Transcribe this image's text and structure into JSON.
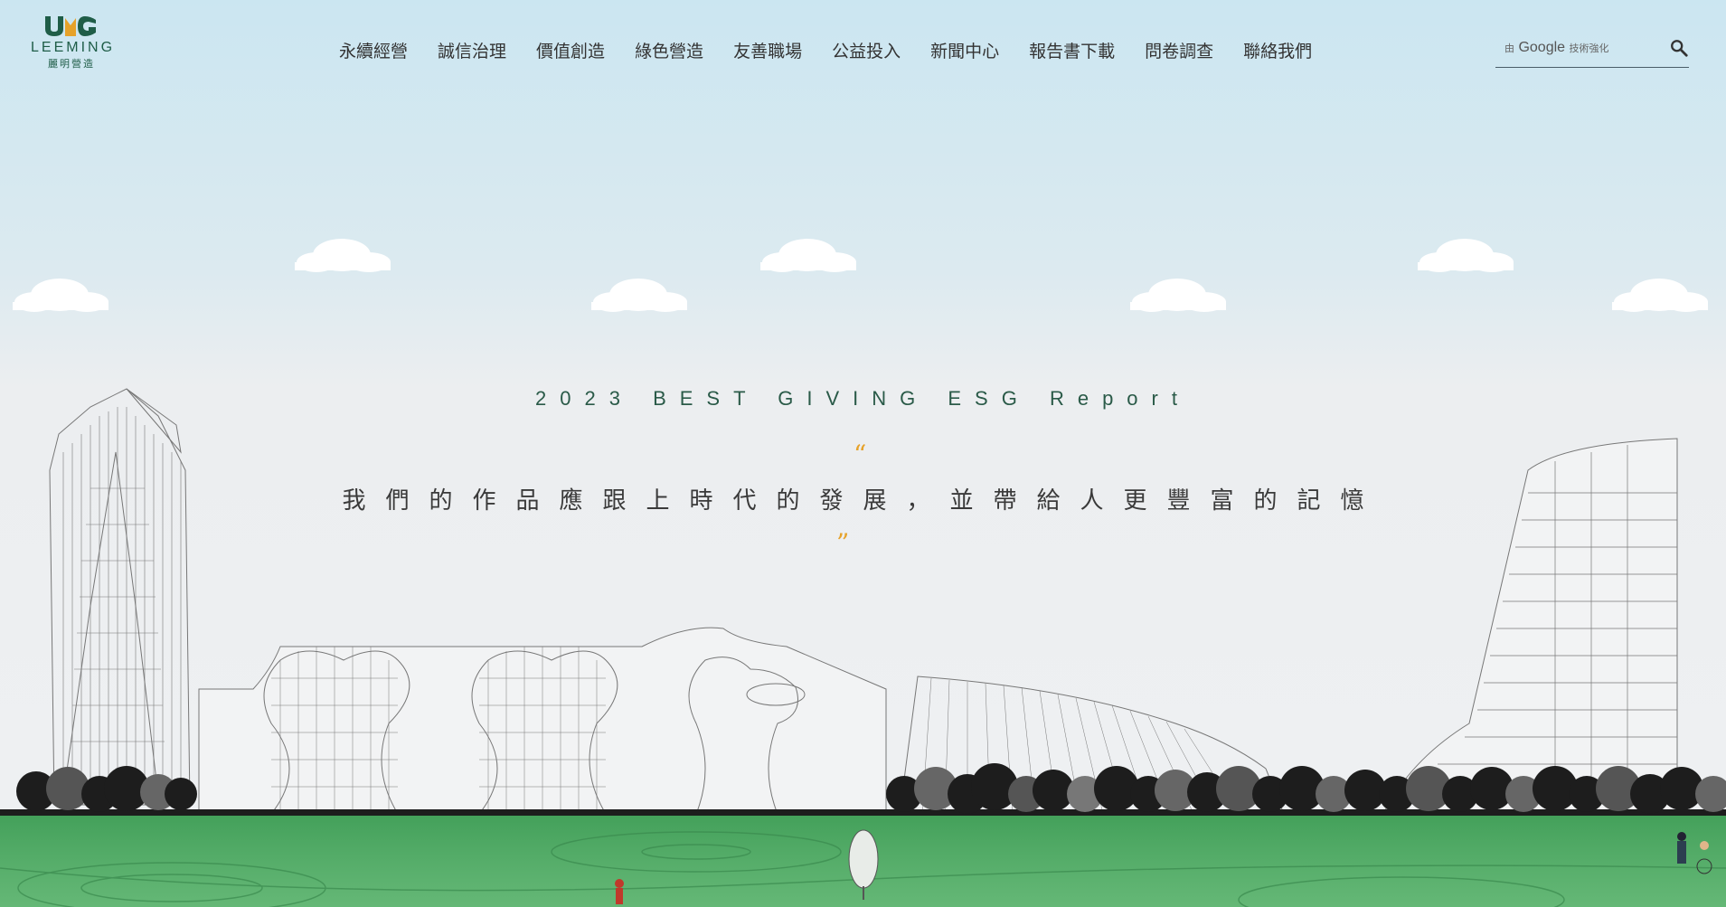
{
  "logo": {
    "wordmark": "LEEMING",
    "subtitle": "麗明營造"
  },
  "nav": {
    "items": [
      {
        "label": "永續經營"
      },
      {
        "label": "誠信治理"
      },
      {
        "label": "價值創造"
      },
      {
        "label": "綠色營造"
      },
      {
        "label": "友善職場"
      },
      {
        "label": "公益投入"
      },
      {
        "label": "新聞中心"
      },
      {
        "label": "報告書下載"
      },
      {
        "label": "問卷調查"
      },
      {
        "label": "聯絡我們"
      }
    ]
  },
  "search": {
    "powered_prefix": "由",
    "brand": "Google",
    "powered_suffix": "技術強化",
    "icon": "search-icon"
  },
  "hero": {
    "headline": "2023 BEST GIVING ESG Report",
    "quote_open": "“",
    "slogan": "我們的作品應跟上時代的發展，並帶給人更豐富的記憶",
    "quote_close": "”"
  },
  "colors": {
    "brand_green": "#1f5d48",
    "accent_orange": "#e6a22a",
    "lawn_green": "#4daa62"
  }
}
